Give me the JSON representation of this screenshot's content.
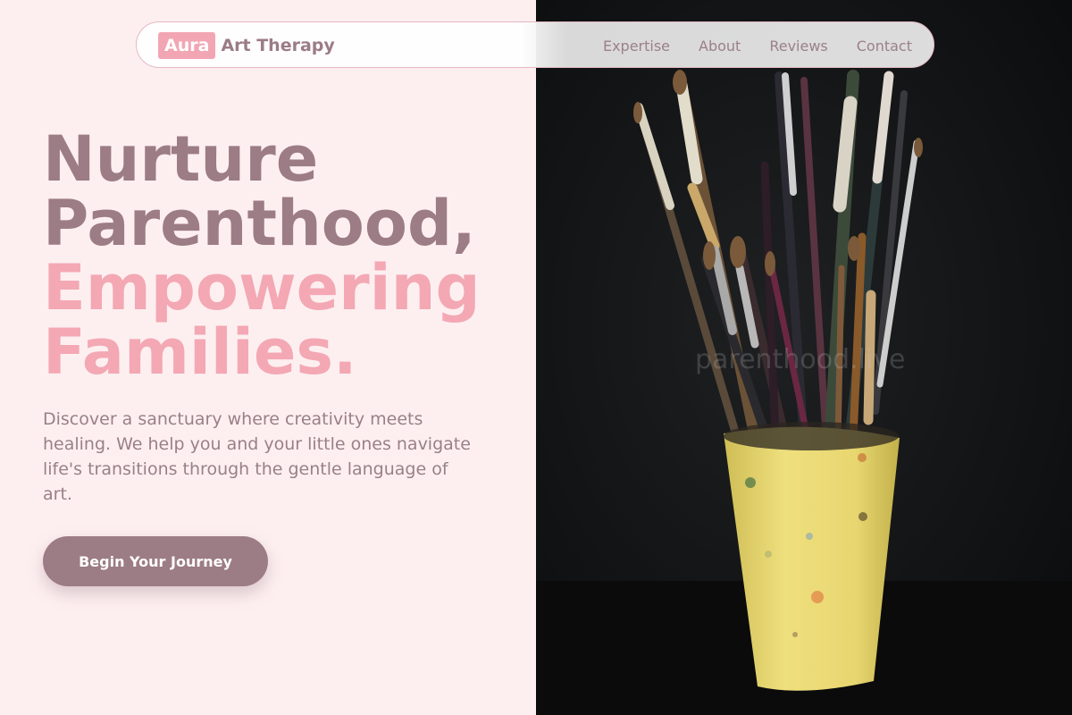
{
  "header": {
    "logo_badge": "Aura",
    "logo_text": "Art Therapy",
    "nav": [
      "Expertise",
      "About",
      "Reviews",
      "Contact"
    ]
  },
  "hero": {
    "title_line1": "Nurture",
    "title_line2": "Parenthood,",
    "title_line3": "Empowering",
    "title_line4": "Families.",
    "description": "Discover a sanctuary where creativity meets healing. We help you and your little ones navigate life's transitions through the gentle language of art.",
    "cta_label": "Begin Your Journey"
  },
  "image": {
    "watermark": "parenthood.live",
    "subject": "paintbrushes in yellow cup"
  },
  "colors": {
    "background": "#fdeff0",
    "accent_pink": "#f3a8b4",
    "mauve": "#9c7c85",
    "photo_background": "#121314",
    "cup_yellow": "#ead772"
  }
}
